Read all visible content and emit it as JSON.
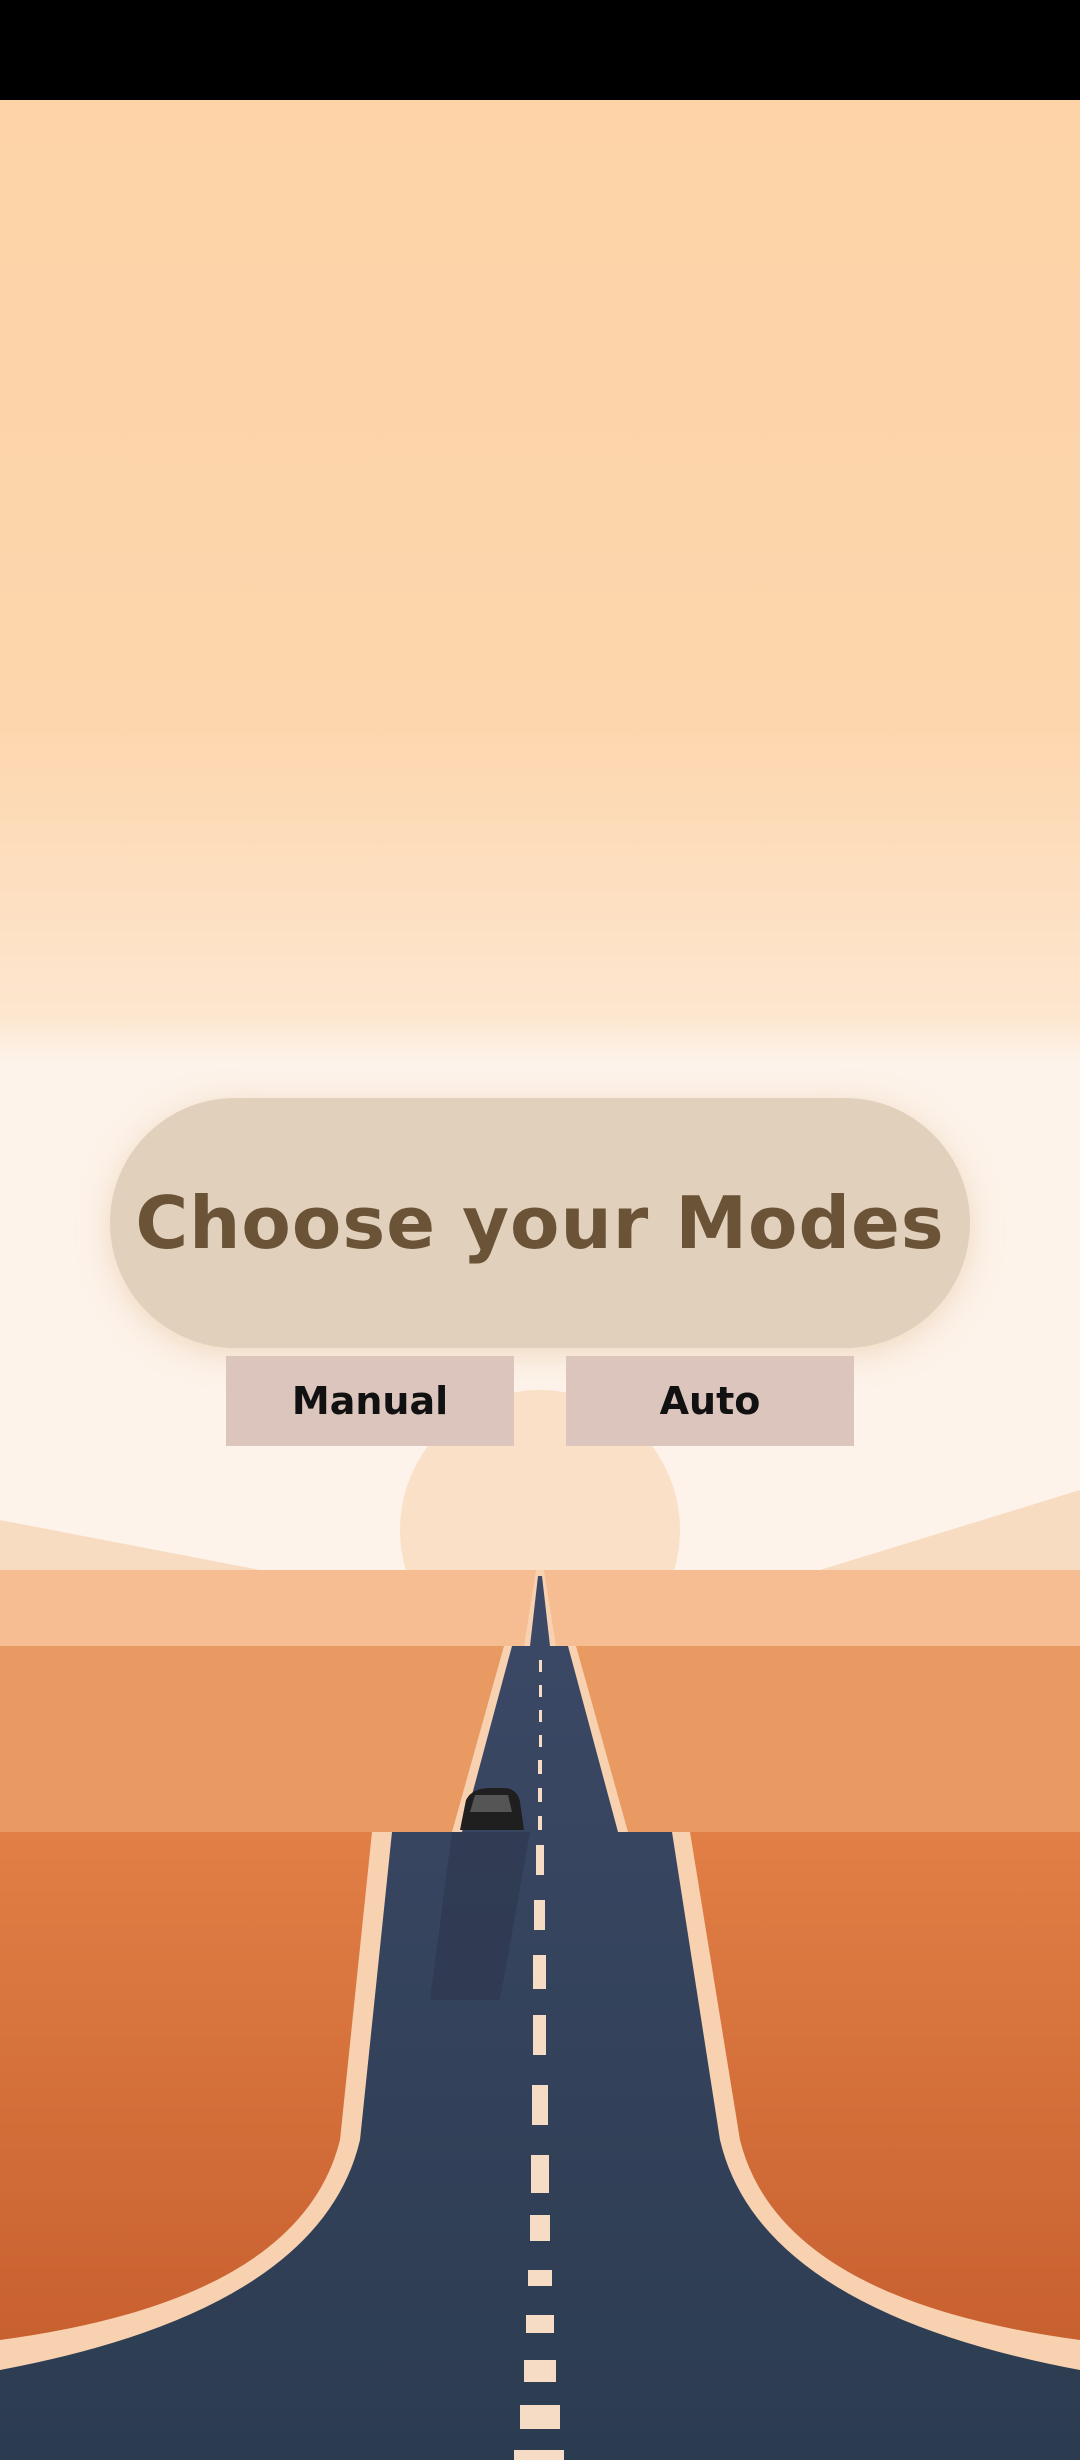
{
  "screen": {
    "title": "Choose your Modes",
    "buttons": {
      "manual_label": "Manual",
      "auto_label": "Auto"
    }
  },
  "colors": {
    "sky_top": "#fdd3a7",
    "sky_horizon": "#fdf3ea",
    "sun": "#fbe0c8",
    "desert_far": "#f6bc92",
    "desert_mid": "#e89a62",
    "desert_near": "#dc7e45",
    "road": "#2f3e55",
    "road_edge": "#f7d1b0",
    "title_pill": "#e1d0bc",
    "title_text": "#6b5337",
    "button_bg": "#dcc5bd",
    "button_text": "#111111"
  },
  "icons": {
    "background": "desert-road-illustration",
    "vehicle": "car-icon"
  }
}
